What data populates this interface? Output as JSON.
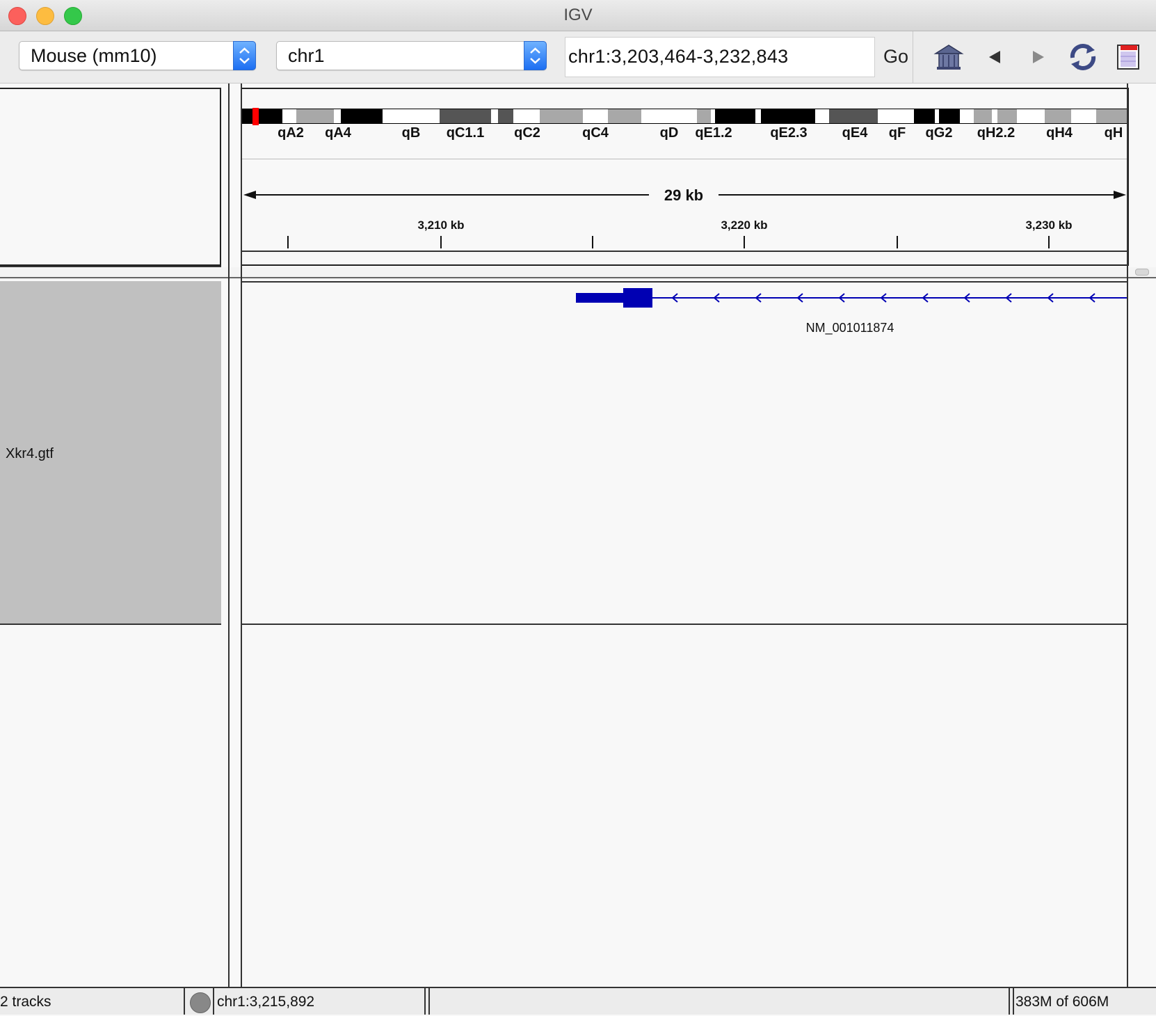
{
  "window": {
    "title": "IGV"
  },
  "toolbar": {
    "genome": "Mouse (mm10)",
    "chromosome": "chr1",
    "locus": "chr1:3,203,464-3,232,843",
    "go_label": "Go",
    "icons": [
      "home-icon",
      "back-arrow-icon",
      "forward-arrow-icon",
      "refresh-icon",
      "roi-icon"
    ]
  },
  "ideogram": {
    "bands": [
      "qA2",
      "qA4",
      "qB",
      "qC1.1",
      "qC2",
      "qC4",
      "qD",
      "qE1.2",
      "qE2.3",
      "qE4",
      "qF",
      "qG2",
      "qH2.2",
      "qH4",
      "qH"
    ]
  },
  "ruler": {
    "span_label": "29 kb",
    "tick_labels": [
      "3,210 kb",
      "3,220 kb",
      "3,230 kb"
    ]
  },
  "tracks": [
    {
      "name": "Xkr4.gtf",
      "feature_label": "NM_001011874",
      "feature_color": "#0000b3",
      "strand": "minus"
    }
  ],
  "status": {
    "tracks": "2 tracks",
    "position": "chr1:3,215,892",
    "memory": "383M of 606M"
  }
}
